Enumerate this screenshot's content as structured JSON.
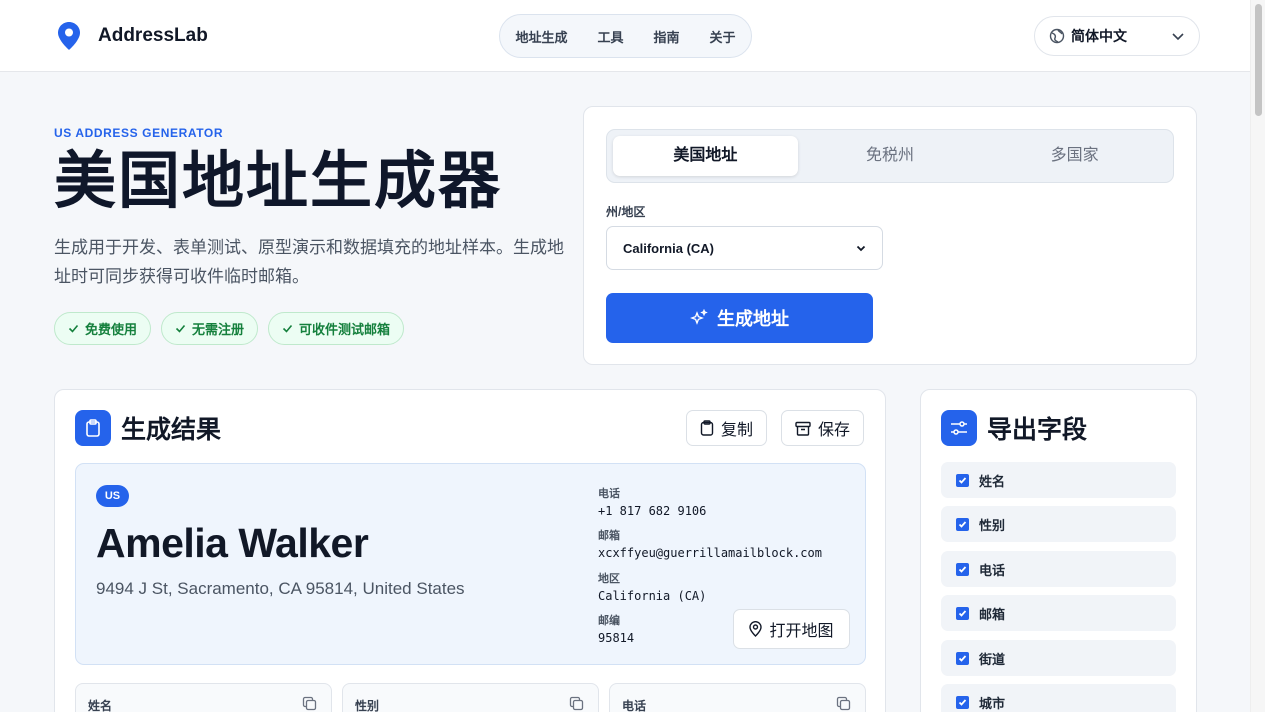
{
  "header": {
    "brand": "AddressLab",
    "nav": [
      "地址生成",
      "工具",
      "指南",
      "关于"
    ],
    "language": "简体中文"
  },
  "hero": {
    "eyebrow": "US ADDRESS GENERATOR",
    "title": "美国地址生成器",
    "description": "生成用于开发、表单测试、原型演示和数据填充的地址样本。生成地址时可同步获得可收件临时邮箱。",
    "badges": [
      "免费使用",
      "无需注册",
      "可收件测试邮箱"
    ]
  },
  "generator": {
    "tabs": [
      "美国地址",
      "免税州",
      "多国家"
    ],
    "active_tab": "美国地址",
    "state_label": "州/地区",
    "state_value": "California (CA)",
    "generate_label": "生成地址"
  },
  "result": {
    "title": "生成结果",
    "copy_label": "复制",
    "save_label": "保存",
    "country_badge": "US",
    "name": "Amelia Walker",
    "full_address": "9494 J St, Sacramento, CA 95814, United States",
    "phone_label": "电话",
    "phone": "+1 817 682 9106",
    "email_label": "邮箱",
    "email": "xcxffyeu@guerrillamailblock.com",
    "region_label": "地区",
    "region": "California (CA)",
    "zip_label": "邮编",
    "zip": "95814",
    "map_label": "打开地图",
    "fields": [
      "姓名",
      "性别",
      "电话"
    ]
  },
  "export": {
    "title": "导出字段",
    "items": [
      "姓名",
      "性别",
      "电话",
      "邮箱",
      "街道",
      "城市"
    ]
  },
  "colors": {
    "accent": "#2563eb",
    "success": "#15803d"
  }
}
